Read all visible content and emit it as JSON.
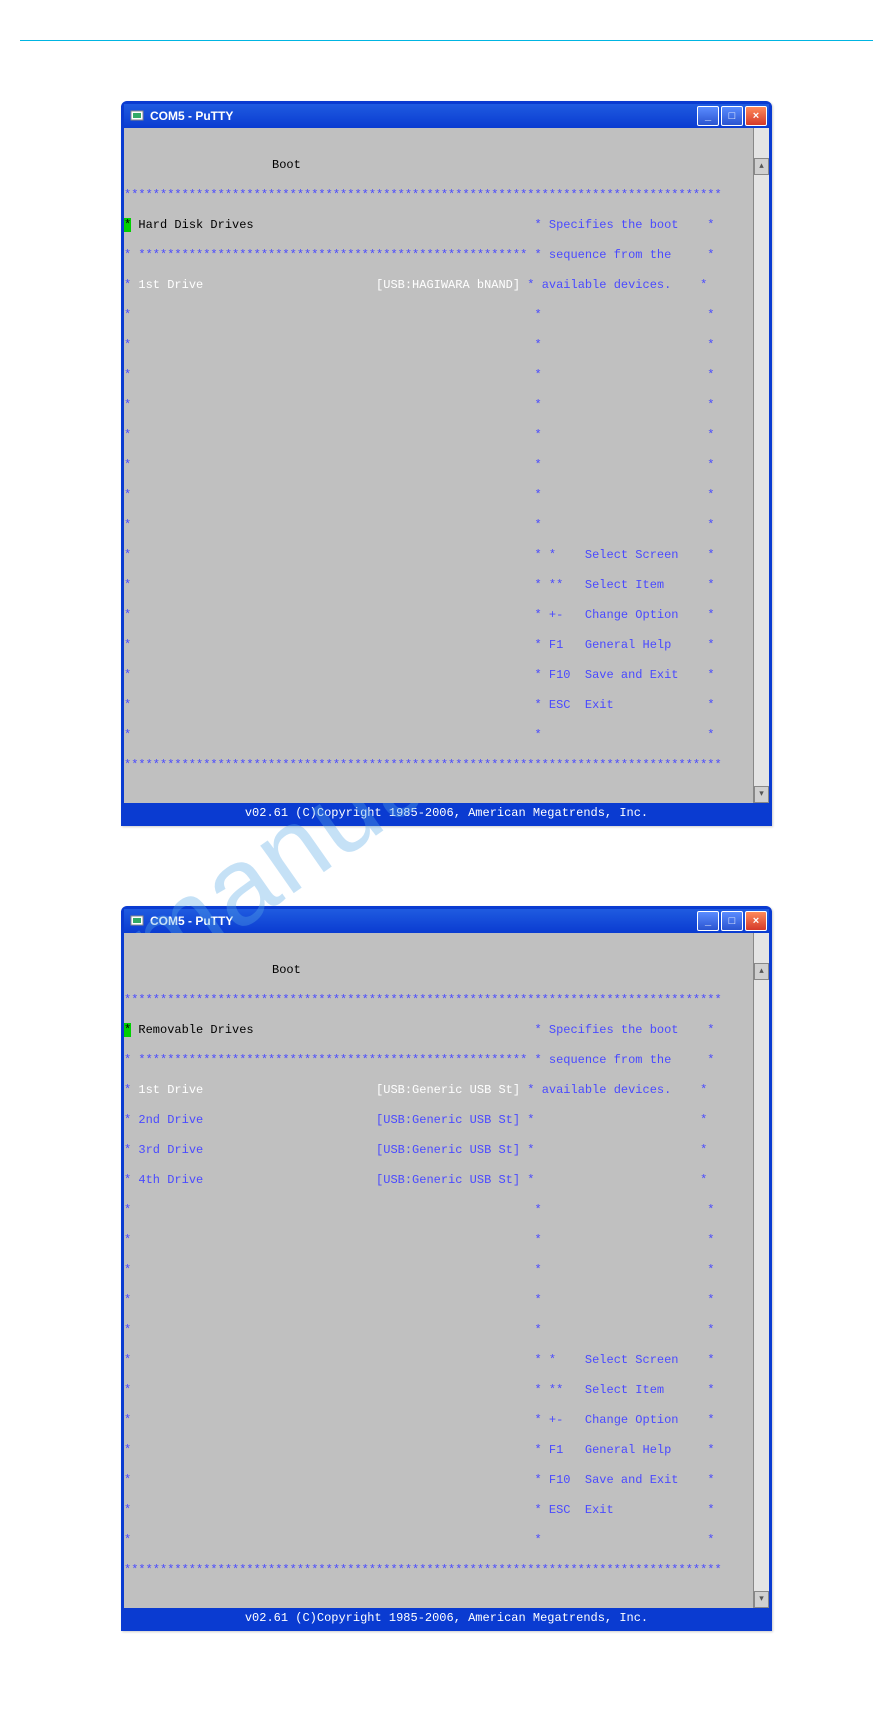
{
  "watermark": "manualslive.co",
  "windows": [
    {
      "title": "COM5 - PuTTY",
      "tab": "Boot",
      "heading": "Hard Disk Drives",
      "help": [
        "Specifies the boot",
        "sequence from the",
        "available devices."
      ],
      "drives": [
        {
          "label": "1st Drive",
          "value": "[USB:HAGIWARA bNAND]",
          "selected": true
        }
      ],
      "legend": [
        {
          "key": "*",
          "desc": "Select Screen"
        },
        {
          "key": "**",
          "desc": "Select Item"
        },
        {
          "key": "+-",
          "desc": "Change Option"
        },
        {
          "key": "F1",
          "desc": "General Help"
        },
        {
          "key": "F10",
          "desc": "Save and Exit"
        },
        {
          "key": "ESC",
          "desc": "Exit"
        }
      ],
      "footer": "v02.61 (C)Copyright 1985-2006, American Megatrends, Inc."
    },
    {
      "title": "COM5 - PuTTY",
      "tab": "Boot",
      "heading": "Removable Drives",
      "help": [
        "Specifies the boot",
        "sequence from the",
        "available devices."
      ],
      "drives": [
        {
          "label": "1st Drive",
          "value": "[USB:Generic USB St]",
          "selected": true
        },
        {
          "label": "2nd Drive",
          "value": "[USB:Generic USB St]",
          "selected": false
        },
        {
          "label": "3rd Drive",
          "value": "[USB:Generic USB St]",
          "selected": false
        },
        {
          "label": "4th Drive",
          "value": "[USB:Generic USB St]",
          "selected": false
        }
      ],
      "legend": [
        {
          "key": "*",
          "desc": "Select Screen"
        },
        {
          "key": "**",
          "desc": "Select Item"
        },
        {
          "key": "+-",
          "desc": "Change Option"
        },
        {
          "key": "F1",
          "desc": "General Help"
        },
        {
          "key": "F10",
          "desc": "Save and Exit"
        },
        {
          "key": "ESC",
          "desc": "Exit"
        }
      ],
      "footer": "v02.61 (C)Copyright 1985-2006, American Megatrends, Inc."
    }
  ]
}
